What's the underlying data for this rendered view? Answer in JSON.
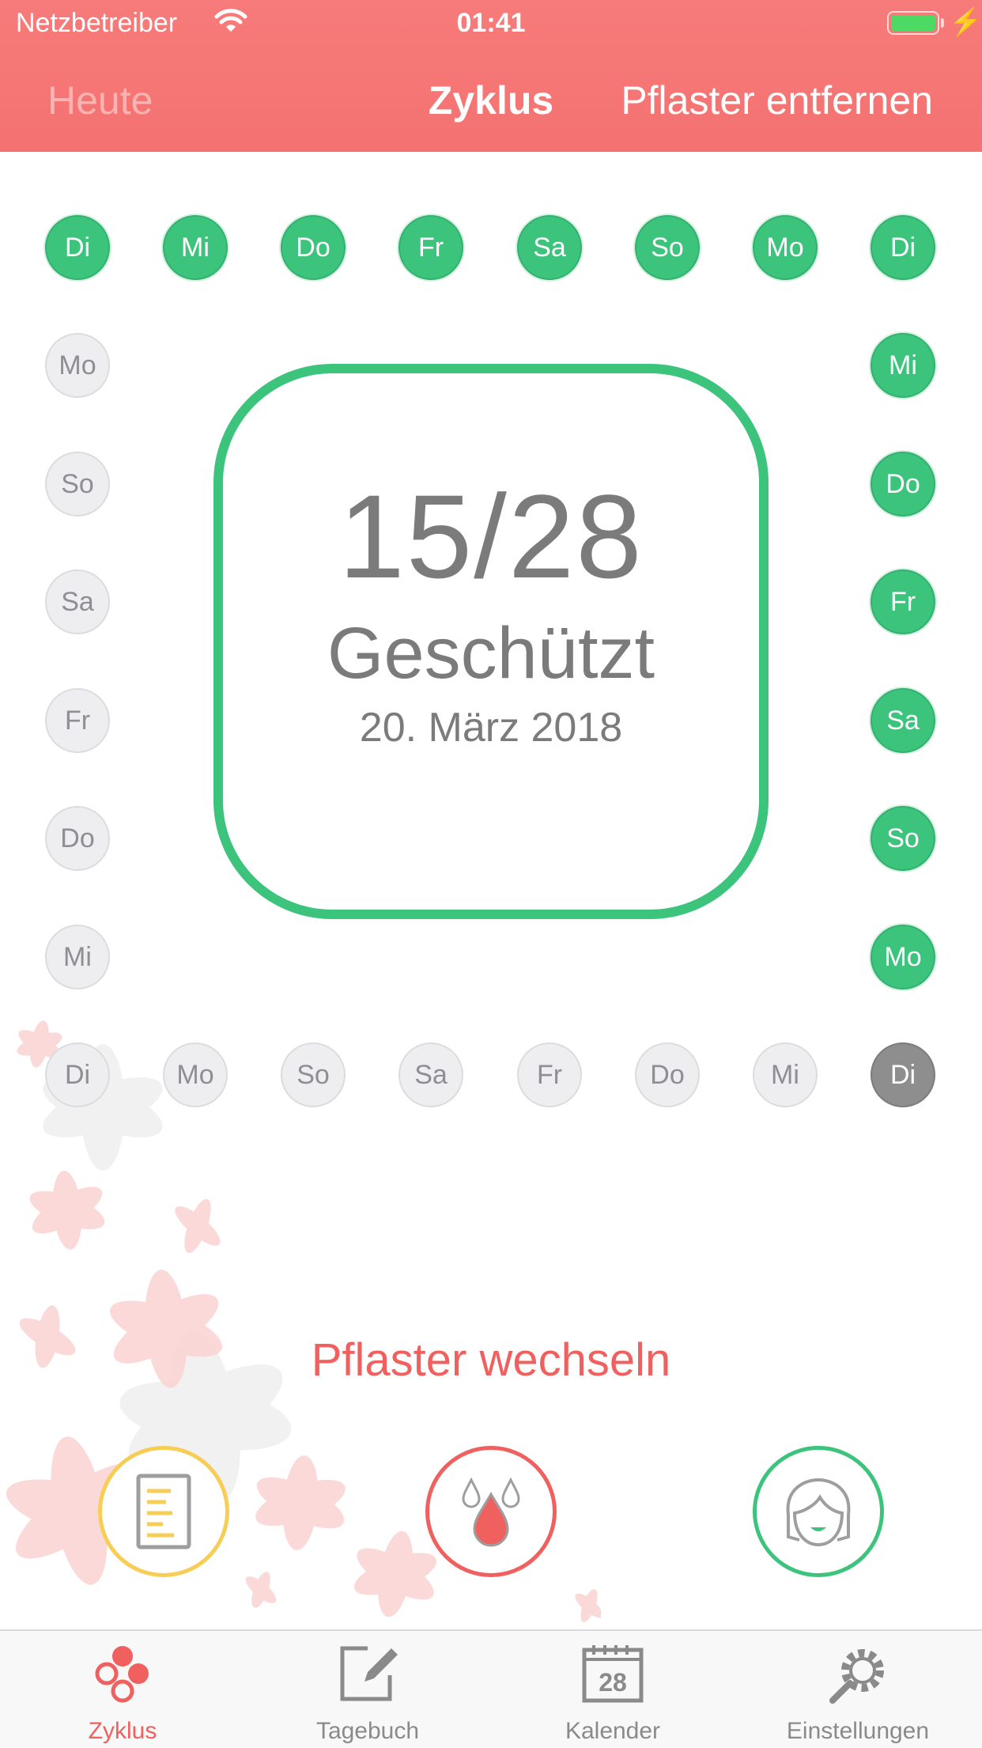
{
  "status_bar": {
    "carrier": "Netzbetreiber",
    "time": "01:41",
    "bolt": "⚡"
  },
  "nav": {
    "left": "Heute",
    "title": "Zyklus",
    "right": "Pflaster entfernen"
  },
  "cycle": {
    "top": [
      "Di",
      "Mi",
      "Do",
      "Fr",
      "Sa",
      "So",
      "Mo",
      "Di"
    ],
    "right": [
      "Mi",
      "Do",
      "Fr",
      "Sa",
      "So",
      "Mo"
    ],
    "bottom": [
      "Di",
      "Mo",
      "So",
      "Sa",
      "Fr",
      "Do",
      "Mi",
      "Di"
    ],
    "left": [
      "Mo",
      "So",
      "Sa",
      "Fr",
      "Do",
      "Mi"
    ]
  },
  "card": {
    "count": "15/28",
    "status": "Geschützt",
    "date": "20. März 2018"
  },
  "change_label": "Pflaster wechseln",
  "actions": {
    "notes_icon": "notes-icon",
    "drop_icon": "blood-drop-icon",
    "face_icon": "face-icon"
  },
  "tabs": [
    {
      "label": "Zyklus",
      "icon": "cycle-dots-icon"
    },
    {
      "label": "Tagebuch",
      "icon": "diary-pencil-icon"
    },
    {
      "label": "Kalender",
      "icon": "calendar-icon",
      "icon_text": "28"
    },
    {
      "label": "Einstellungen",
      "icon": "settings-gear-icon"
    }
  ],
  "colors": {
    "header": "#f47271",
    "active_green": "#3cc47c",
    "accent_red": "#f0605e",
    "notes_yellow": "#f8cd55"
  }
}
